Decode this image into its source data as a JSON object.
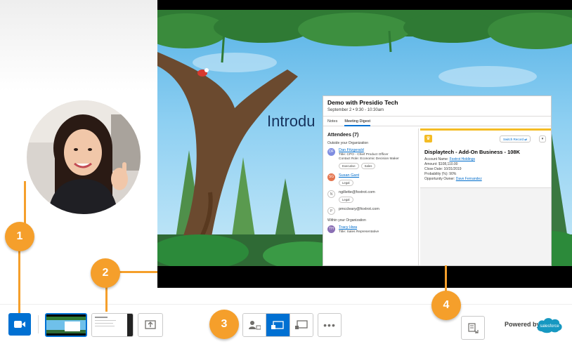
{
  "slide": {
    "title": "Introdu"
  },
  "record_card": {
    "title": "Demo with Presidio Tech",
    "subtitle": "September 2  •  9:30 - 10:30am",
    "tabs": [
      "Notes",
      "Meeting Digest"
    ],
    "active_tab": "Meeting Digest",
    "attendees_heading": "Attendees (7)",
    "outside_group": "Outside your Organization",
    "within_group": "Within your Organization",
    "attendees": [
      {
        "initials": "DF",
        "name": "Dan Fitzgerald",
        "linked": true,
        "lines": [
          "Title: CPO - Chief Product Officer",
          "Contact Role: Economic Decision Maker"
        ],
        "tags": [
          "Executive",
          "Sales"
        ]
      },
      {
        "initials": "SG",
        "name": "Susan Gant",
        "linked": true,
        "lines": [],
        "tags": [
          "Legal"
        ]
      },
      {
        "initials": "N",
        "name": "ngillette@foxtrot.com",
        "linked": false,
        "lines": [],
        "tags": [
          "Legal"
        ]
      },
      {
        "initials": "P",
        "name": "pmccleary@foxtrot.com",
        "linked": false,
        "lines": [],
        "tags": []
      }
    ],
    "internal_attendee": {
      "initials": "TH",
      "name": "Tracy Hwa",
      "lines": [
        "Title: Sales Representative"
      ]
    },
    "switch_record_label": "Switch Record",
    "opportunity": {
      "name": "Displaytech - Add-On Business - 108K",
      "account_label": "Account Name:",
      "account_value": "Foxtrot Holdings",
      "amount_label": "Amount:",
      "amount_value": "$108,110.00",
      "close_label": "Close Date:",
      "close_value": "10/31/2019",
      "prob_label": "Probability (%):",
      "prob_value": "90%",
      "owner_label": "Opportunity Owner:",
      "owner_value": "Dave Fernandez"
    }
  },
  "toolbar": {
    "powered_by": "Powered by",
    "brand": "salesforce"
  },
  "callouts": [
    "1",
    "2",
    "3",
    "4"
  ],
  "colors": {
    "accent": "#0070d2",
    "callout": "#f59f2b",
    "highlight_border": "#f4bc25"
  },
  "icons": {
    "camera": "video-camera-icon",
    "share": "share-screen-icon",
    "layout_speaker": "speaker-layout-icon",
    "layout_screen": "screen-focus-layout-icon",
    "layout_presenter": "presenter-layout-icon",
    "more": "more-icon",
    "notes": "notes-popout-icon"
  }
}
